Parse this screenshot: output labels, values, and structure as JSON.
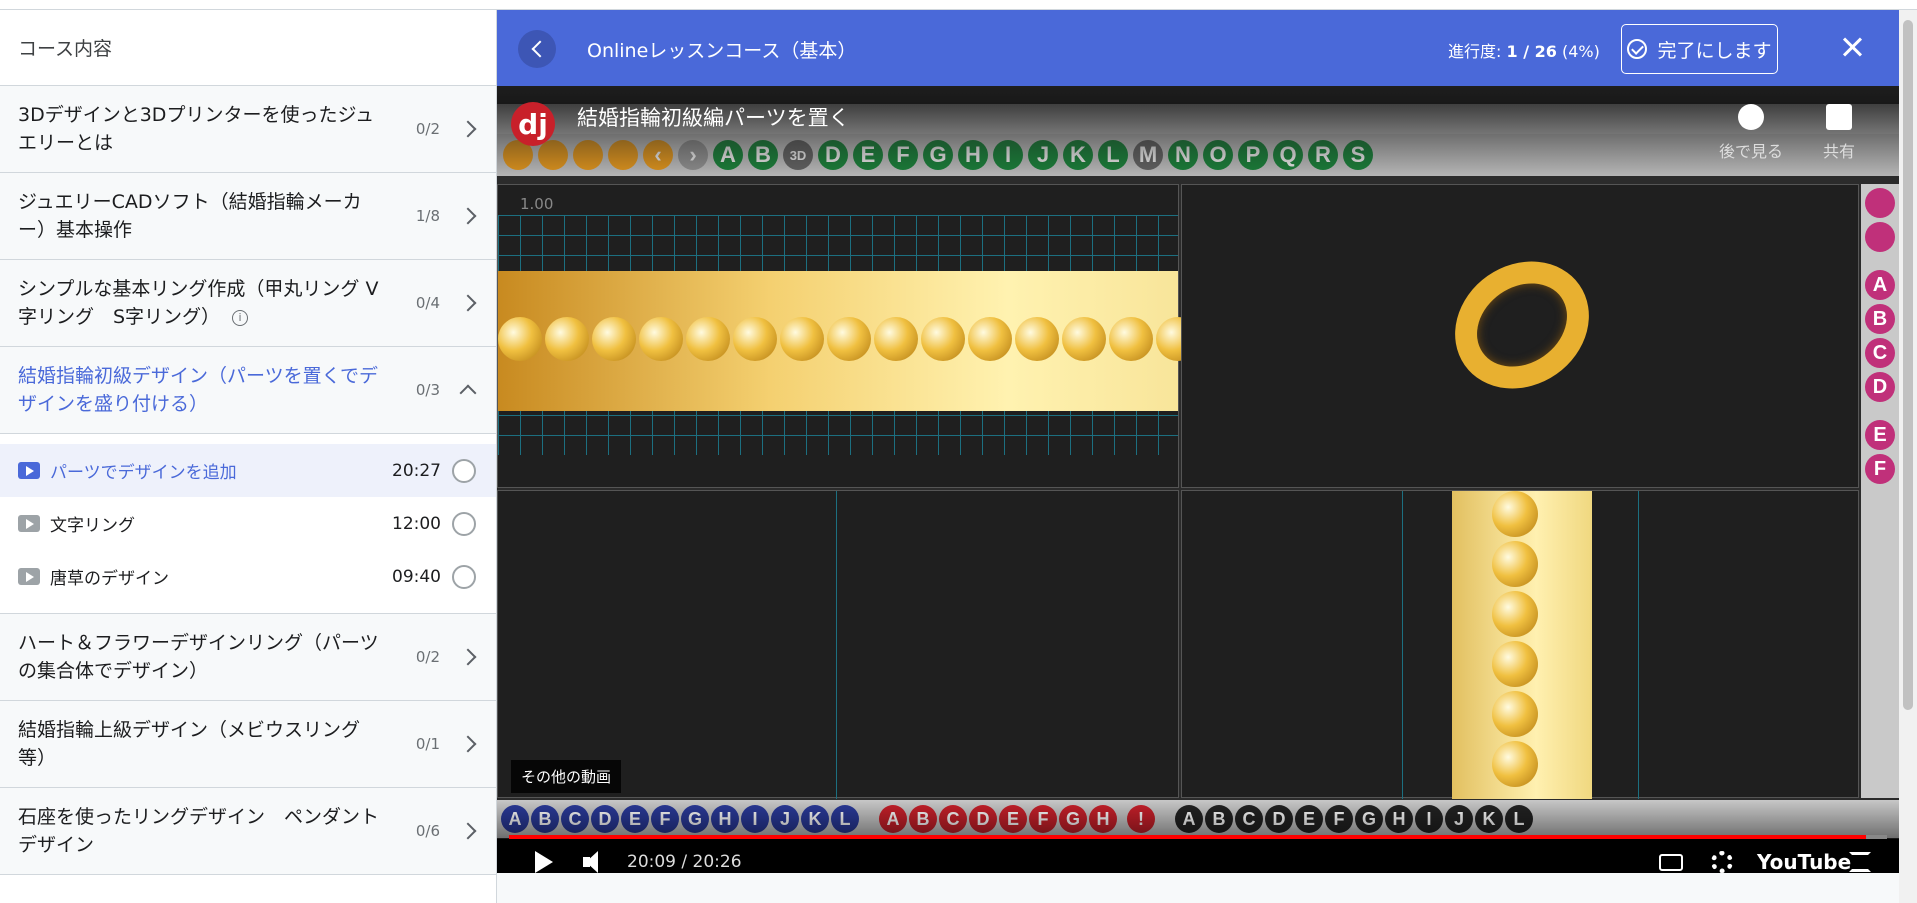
{
  "sidebar": {
    "header": "コース内容",
    "sections_top": [
      {
        "title": "3Dデザインと3Dプリンターを使ったジュエリーとは",
        "count": "0/2"
      },
      {
        "title": "ジュエリーCADソフト（結婚指輪メーカー）基本操作",
        "count": "1/8"
      },
      {
        "title": "シンプルな基本リング作成（甲丸リング V字リング　S字リング）",
        "count": "0/4"
      }
    ],
    "active_section": {
      "title": "結婚指輪初級デザイン（パーツを置くでデザインを盛り付ける）",
      "count": "0/3"
    },
    "lessons": [
      {
        "title": "パーツでデザインを追加",
        "duration": "20:27"
      },
      {
        "title": "文字リング",
        "duration": "12:00"
      },
      {
        "title": "唐草のデザイン",
        "duration": "09:40"
      }
    ],
    "sections_bottom": [
      {
        "title": "ハート＆フラワーデザインリング（パーツの集合体でデザイン）",
        "count": "0/2"
      },
      {
        "title": "結婚指輪上級デザイン（メビウスリング等）",
        "count": "0/1"
      },
      {
        "title": "石座を使ったリングデザイン　ペンダントデザイン",
        "count": "0/6"
      }
    ]
  },
  "header": {
    "course_title": "Onlineレッスンコース（基本）",
    "progress_label": "進行度:",
    "progress_value": "1 / 26",
    "progress_percent": "(4%)",
    "complete_label": "完了にします"
  },
  "player": {
    "channel_logo": "dj",
    "video_title": "結婚指輪初級編パーツを置く",
    "watch_later": "後で見る",
    "share": "共有",
    "more_videos": "その他の動画",
    "time": "20:09 / 20:26",
    "progress_fraction": 0.985,
    "brand": "YouTube",
    "app_toolbar_letters": [
      "A",
      "B",
      "3D",
      "D",
      "E",
      "F",
      "G",
      "H",
      "I",
      "J",
      "K",
      "L",
      "M",
      "N",
      "O",
      "P",
      "Q",
      "R",
      "S"
    ],
    "right_palette_letters": [
      "A",
      "B",
      "C",
      "D",
      "E",
      "F"
    ],
    "bottom_palette_blue": [
      "A",
      "B",
      "C",
      "D",
      "E",
      "F",
      "G",
      "H",
      "I",
      "J",
      "K",
      "L"
    ],
    "bottom_palette_red": [
      "A",
      "B",
      "C",
      "D",
      "E",
      "F",
      "G",
      "H",
      "!"
    ],
    "bottom_palette_black": [
      "A",
      "B",
      "C",
      "D",
      "E",
      "F",
      "G",
      "H",
      "I",
      "J",
      "K",
      "L"
    ],
    "scale_label": "1.00"
  },
  "colors": {
    "accent": "#4a69d9",
    "text": "#1c1d1f",
    "muted": "#6a6f73",
    "youtube_red": "#ff0000"
  }
}
